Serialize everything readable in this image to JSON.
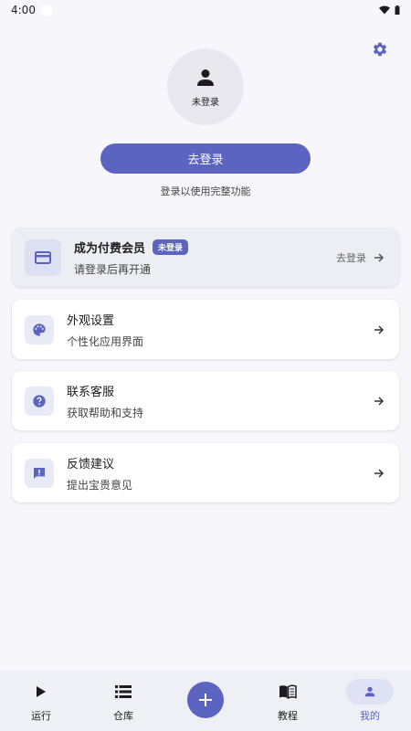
{
  "status": {
    "time": "4:00"
  },
  "profile": {
    "avatar_label": "未登录"
  },
  "login": {
    "button_label": "去登录",
    "hint": "登录以使用完整功能"
  },
  "vip_card": {
    "title": "成为付费会员",
    "badge": "未登录",
    "subtitle": "请登录后再开通",
    "action_label": "去登录"
  },
  "menu": [
    {
      "title": "外观设置",
      "subtitle": "个性化应用界面",
      "icon": "palette-icon"
    },
    {
      "title": "联系客服",
      "subtitle": "获取帮助和支持",
      "icon": "help-icon"
    },
    {
      "title": "反馈建议",
      "subtitle": "提出宝贵意见",
      "icon": "feedback-icon"
    }
  ],
  "nav": [
    {
      "label": "运行",
      "icon": "play-icon"
    },
    {
      "label": "仓库",
      "icon": "list-icon"
    },
    {
      "label": "教程",
      "icon": "book-icon"
    },
    {
      "label": "我的",
      "icon": "person-icon",
      "active": true
    }
  ],
  "colors": {
    "accent": "#5b64c0",
    "background": "#f7f7fb"
  }
}
